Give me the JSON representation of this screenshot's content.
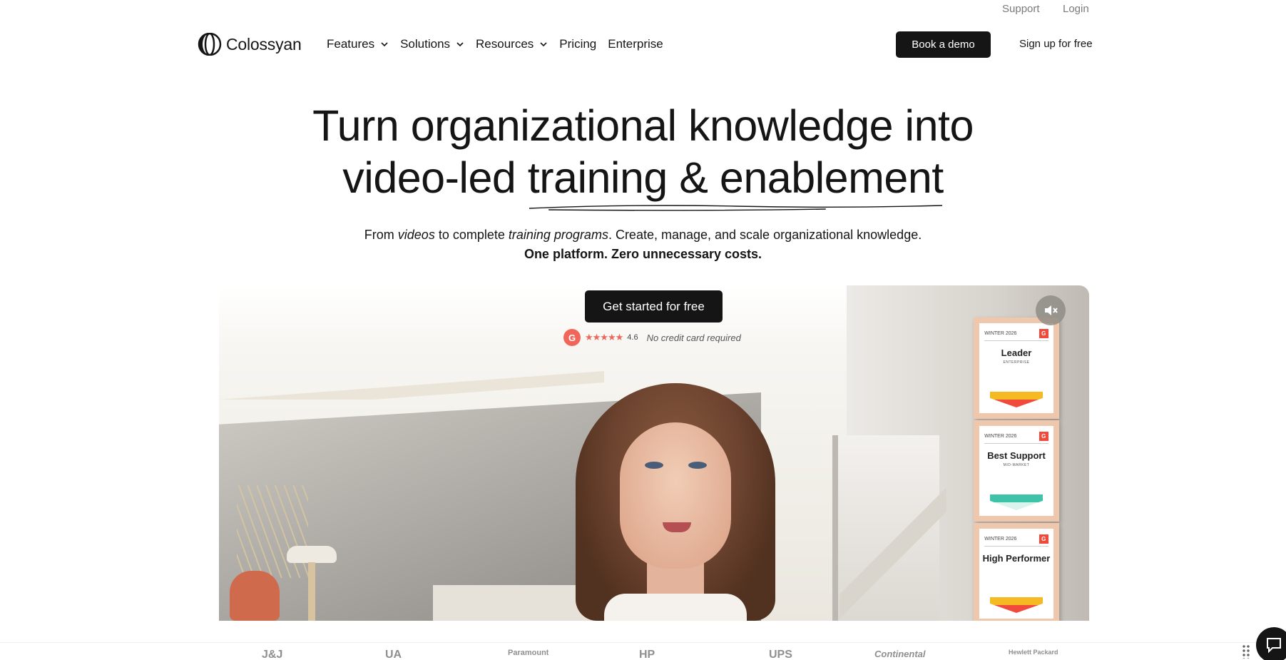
{
  "topbar": {
    "support": "Support",
    "login": "Login"
  },
  "brand": {
    "name": "Colossyan"
  },
  "nav": {
    "items": [
      {
        "label": "Features",
        "dropdown": true
      },
      {
        "label": "Solutions",
        "dropdown": true
      },
      {
        "label": "Resources",
        "dropdown": true
      },
      {
        "label": "Pricing",
        "dropdown": false
      },
      {
        "label": "Enterprise",
        "dropdown": false
      }
    ],
    "book_demo": "Book a demo",
    "signup": "Sign up for free"
  },
  "hero": {
    "title_line1": "Turn organizational knowledge into",
    "title_line2_a": "video-led ",
    "title_line2_b": "training & enablement",
    "subtitle_a": "From ",
    "subtitle_em1": "videos",
    "subtitle_b": " to complete ",
    "subtitle_em2": "training programs",
    "subtitle_c": ". Create, manage, and scale organizational knowledge.",
    "subtitle_strong": "One platform. Zero unnecessary costs."
  },
  "cta": {
    "label": "Get started for free",
    "g2_letter": "G",
    "stars": "★★★★★",
    "rating": "4.6",
    "no_credit": "No credit card required",
    "rating_value": 4.6
  },
  "video": {
    "badges": [
      {
        "season": "WINTER 2026",
        "title": "Leader",
        "sub": "ENTERPRISE",
        "color": "#f5b923"
      },
      {
        "season": "WINTER 2026",
        "title": "Best Support",
        "sub": "MID-MARKET",
        "color": "#3ec2a8"
      },
      {
        "season": "WINTER 2026",
        "title": "High Performer",
        "sub": "",
        "color": "#f5b923"
      }
    ],
    "mute_icon": "speaker-muted-icon"
  },
  "customer_logos": [
    "J&J",
    "UA",
    "Paramount",
    "HP",
    "UPS",
    "Continental",
    "Hewlett Packard"
  ],
  "chat": {
    "icon": "chat-bubble-icon"
  },
  "colors": {
    "primary": "#151515",
    "g2": "#f0665a"
  }
}
